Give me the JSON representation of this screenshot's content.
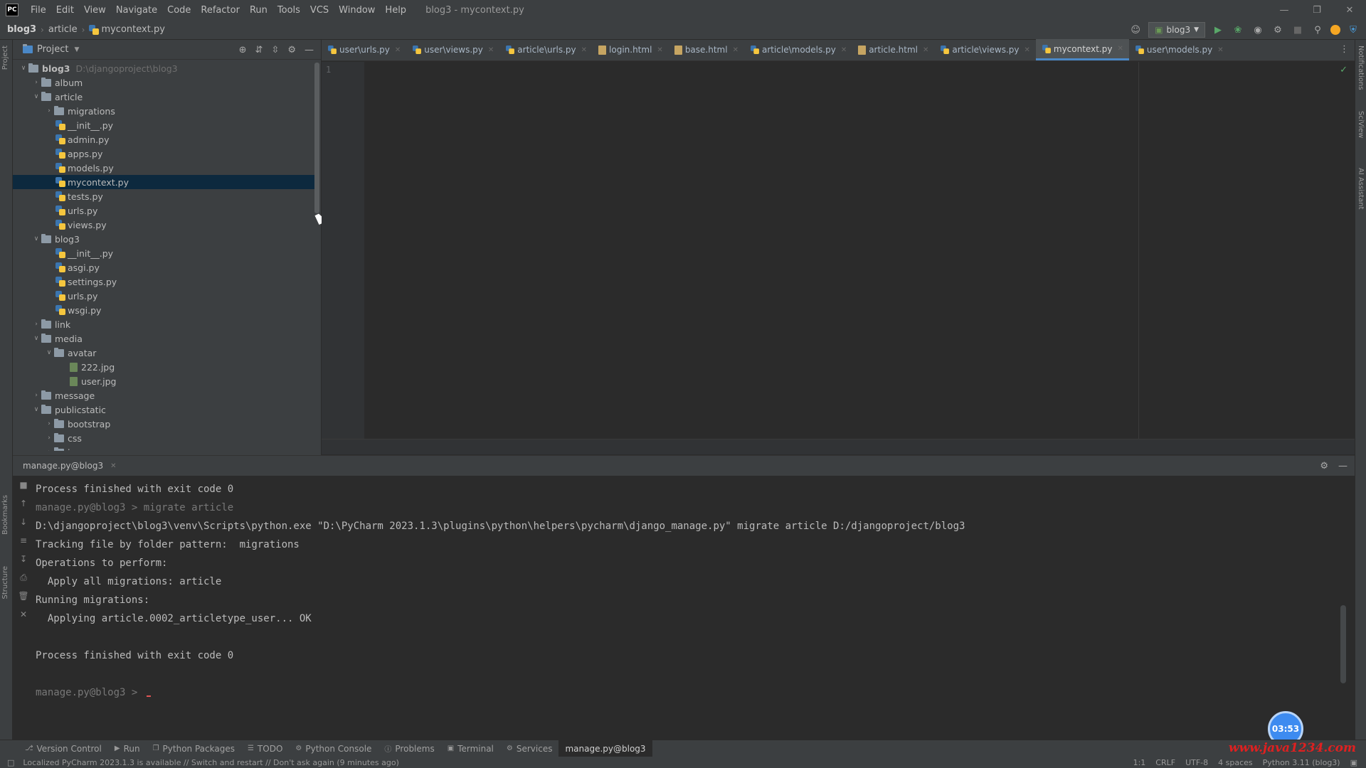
{
  "menu": {
    "items": [
      "File",
      "Edit",
      "View",
      "Navigate",
      "Code",
      "Refactor",
      "Run",
      "Tools",
      "VCS",
      "Window",
      "Help"
    ],
    "window_title": "blog3 - mycontext.py"
  },
  "navbar": {
    "crumbs": [
      "blog3",
      "article",
      "mycontext.py"
    ],
    "run_config": "blog3"
  },
  "project": {
    "title": "Project",
    "tree": [
      {
        "label": "blog3",
        "secondary": "D:\\djangoproject\\blog3",
        "depth": 0,
        "type": "folder",
        "expanded": true,
        "bold": true
      },
      {
        "label": "album",
        "depth": 1,
        "type": "folder",
        "expanded": false
      },
      {
        "label": "article",
        "depth": 1,
        "type": "folder",
        "expanded": true
      },
      {
        "label": "migrations",
        "depth": 2,
        "type": "folder",
        "expanded": false
      },
      {
        "label": "__init__.py",
        "depth": 3,
        "type": "py"
      },
      {
        "label": "admin.py",
        "depth": 3,
        "type": "py"
      },
      {
        "label": "apps.py",
        "depth": 3,
        "type": "py"
      },
      {
        "label": "models.py",
        "depth": 3,
        "type": "py"
      },
      {
        "label": "mycontext.py",
        "depth": 3,
        "type": "py",
        "selected": true
      },
      {
        "label": "tests.py",
        "depth": 3,
        "type": "py"
      },
      {
        "label": "urls.py",
        "depth": 3,
        "type": "py"
      },
      {
        "label": "views.py",
        "depth": 3,
        "type": "py"
      },
      {
        "label": "blog3",
        "depth": 1,
        "type": "folder",
        "expanded": true
      },
      {
        "label": "__init__.py",
        "depth": 3,
        "type": "py"
      },
      {
        "label": "asgi.py",
        "depth": 3,
        "type": "py"
      },
      {
        "label": "settings.py",
        "depth": 3,
        "type": "py"
      },
      {
        "label": "urls.py",
        "depth": 3,
        "type": "py"
      },
      {
        "label": "wsgi.py",
        "depth": 3,
        "type": "py"
      },
      {
        "label": "link",
        "depth": 1,
        "type": "folder",
        "expanded": false
      },
      {
        "label": "media",
        "depth": 1,
        "type": "folder",
        "expanded": true
      },
      {
        "label": "avatar",
        "depth": 2,
        "type": "folder",
        "expanded": true
      },
      {
        "label": "222.jpg",
        "depth": 4,
        "type": "img"
      },
      {
        "label": "user.jpg",
        "depth": 4,
        "type": "img"
      },
      {
        "label": "message",
        "depth": 1,
        "type": "folder",
        "expanded": false
      },
      {
        "label": "publicstatic",
        "depth": 1,
        "type": "folder",
        "expanded": true
      },
      {
        "label": "bootstrap",
        "depth": 2,
        "type": "folder",
        "expanded": false
      },
      {
        "label": "css",
        "depth": 2,
        "type": "folder",
        "expanded": false
      },
      {
        "label": "images",
        "depth": 2,
        "type": "folder",
        "expanded": false
      }
    ]
  },
  "editor": {
    "tabs": [
      {
        "label": "user\\urls.py",
        "kind": "py"
      },
      {
        "label": "user\\views.py",
        "kind": "py"
      },
      {
        "label": "article\\urls.py",
        "kind": "py"
      },
      {
        "label": "login.html",
        "kind": "html"
      },
      {
        "label": "base.html",
        "kind": "html"
      },
      {
        "label": "article\\models.py",
        "kind": "py"
      },
      {
        "label": "article.html",
        "kind": "html"
      },
      {
        "label": "article\\views.py",
        "kind": "py"
      },
      {
        "label": "mycontext.py",
        "kind": "py",
        "active": true
      },
      {
        "label": "user\\models.py",
        "kind": "py"
      }
    ],
    "line_number": "1"
  },
  "run_panel": {
    "tab_label": "manage.py@blog3",
    "lines": [
      {
        "text": "Process finished with exit code 0",
        "dim": false
      },
      {
        "text": "manage.py@blog3 > migrate article",
        "dim": true
      },
      {
        "text": "D:\\djangoproject\\blog3\\venv\\Scripts\\python.exe \"D:\\PyCharm 2023.1.3\\plugins\\python\\helpers\\pycharm\\django_manage.py\" migrate article D:/djangoproject/blog3",
        "dim": false
      },
      {
        "text": "Tracking file by folder pattern:  migrations",
        "dim": false
      },
      {
        "text": "Operations to perform:",
        "dim": false
      },
      {
        "text": "  Apply all migrations: article",
        "dim": false
      },
      {
        "text": "Running migrations:",
        "dim": false
      },
      {
        "text": "  Applying article.0002_articletype_user... OK",
        "dim": false
      },
      {
        "text": "",
        "dim": false
      },
      {
        "text": "Process finished with exit code 0",
        "dim": false
      },
      {
        "text": "",
        "dim": false
      },
      {
        "text": "manage.py@blog3 > ",
        "dim": true,
        "prompt": true
      }
    ]
  },
  "timer": "03:53",
  "toolwindows": [
    {
      "label": "Version Control",
      "icon": "branch-icon"
    },
    {
      "label": "Run",
      "icon": "play-icon"
    },
    {
      "label": "Python Packages",
      "icon": "package-icon"
    },
    {
      "label": "TODO",
      "icon": "list-icon"
    },
    {
      "label": "Python Console",
      "icon": "console-icon"
    },
    {
      "label": "Problems",
      "icon": "problems-icon"
    },
    {
      "label": "Terminal",
      "icon": "terminal-icon"
    },
    {
      "label": "Services",
      "icon": "services-icon"
    },
    {
      "label": "manage.py@blog3",
      "icon": "",
      "active": true
    }
  ],
  "watermark": "www.java1234.com",
  "status": {
    "message": "Localized PyCharm 2023.1.3 is available // Switch and restart // Don't ask again (9 minutes ago)",
    "position": "1:1",
    "line_sep": "CRLF",
    "encoding": "UTF-8",
    "indent": "4 spaces",
    "interpreter": "Python 3.11 (blog3)"
  },
  "left_strip": [
    "Project",
    "Bookmarks",
    "Structure"
  ],
  "right_strip": [
    "Notifications",
    "SciView",
    "AI Assistant"
  ],
  "colors": {
    "accent": "#4a88c7",
    "selection": "#0d293e",
    "run_green": "#59a869",
    "watermark": "#e02020"
  }
}
